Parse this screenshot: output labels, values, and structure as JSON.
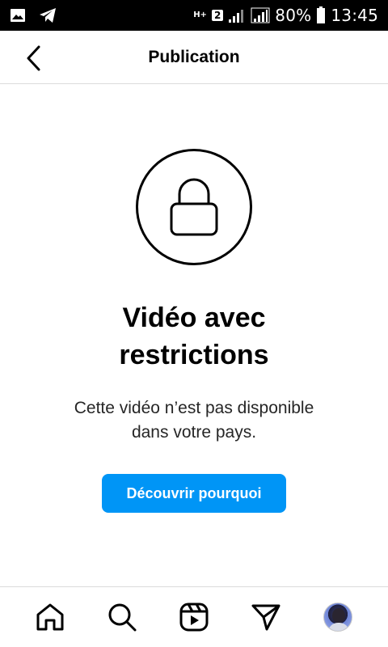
{
  "status_bar": {
    "battery": "80%",
    "time": "13:45",
    "sim_slot": "2",
    "network_type": "H+",
    "icons": [
      "gallery-icon",
      "telegram-icon",
      "network-h-plus-icon",
      "sim-2-icon",
      "signal-icon",
      "signal-icon",
      "battery-icon"
    ]
  },
  "header": {
    "title": "Publication",
    "back_icon": "chevron-left-icon"
  },
  "main": {
    "icon": "lock-icon",
    "title_line1": "Vidéo avec",
    "title_line2": "restrictions",
    "description_line1": "Cette vidéo n’est pas disponible",
    "description_line2": "dans votre pays.",
    "cta_label": "Découvrir pourquoi",
    "cta_color": "#0095f6"
  },
  "bottom_nav": {
    "items": [
      "home-icon",
      "search-icon",
      "reels-icon",
      "direct-send-icon",
      "profile-avatar"
    ]
  }
}
